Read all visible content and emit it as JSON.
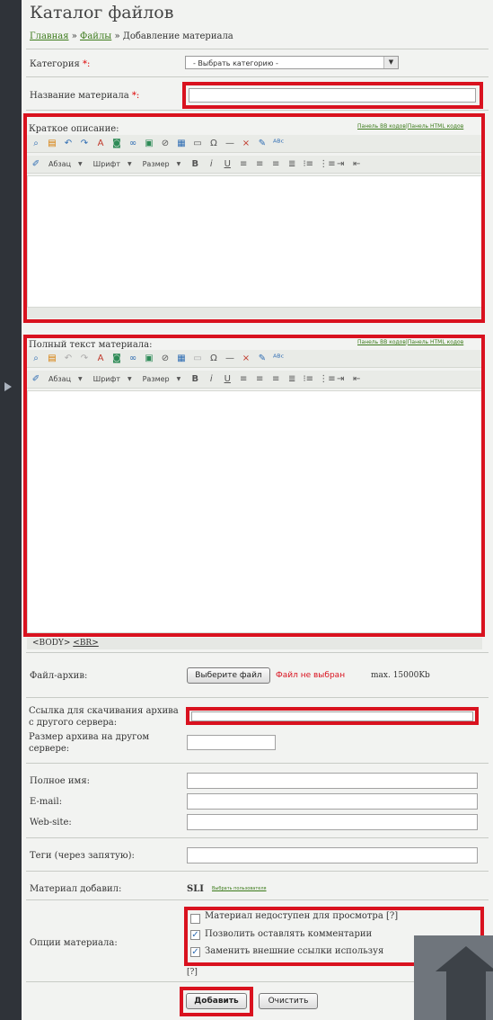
{
  "header": {
    "title": "Каталог файлов",
    "breadcrumb": {
      "home": "Главная",
      "sep1": "»",
      "files": "Файлы",
      "sep2": "»",
      "current": "Добавление материала"
    }
  },
  "form": {
    "category": {
      "label": "Категория",
      "required_mark": "*:",
      "value": "- Выбрать категорию -"
    },
    "title": {
      "label": "Название материала",
      "required_mark": "*:",
      "value": ""
    },
    "short_desc": {
      "label": "Краткое описание:"
    },
    "full_text": {
      "label": "Полный текст материала:"
    },
    "editor_links": {
      "bb": "Панель BB кодов",
      "divider": "|",
      "html": "Панель HTML кодов"
    },
    "editor_toolbar": {
      "paragraph": "Абзац",
      "font": "Шрифт",
      "size": "Размер",
      "bold": "B",
      "italic": "i",
      "underline": "U"
    },
    "status_path": {
      "body": "<BODY>",
      "br": "<BR>"
    },
    "archive": {
      "label": "Файл-архив:",
      "button": "Выберите файл",
      "no_file": "Файл не выбран",
      "max": "max. 15000Kb"
    },
    "external_link": {
      "label": "Ссылка для скачивания архива с другого сервера:",
      "value": ""
    },
    "external_size": {
      "label": "Размер архива на другом сервере:",
      "value": ""
    },
    "full_name": {
      "label": "Полное имя:",
      "value": ""
    },
    "email": {
      "label": "E-mail:",
      "value": ""
    },
    "website": {
      "label": "Web-site:",
      "value": ""
    },
    "tags": {
      "label": "Теги (через запятую):",
      "value": ""
    },
    "added_by": {
      "label": "Материал добавил:",
      "user": "SLI",
      "choose_link": "Выбрать пользователя"
    },
    "options": {
      "label": "Опции материала:",
      "items": [
        {
          "label": "Материал недоступен для просмотра [?]",
          "checked": false
        },
        {
          "label": "Позволить оставлять комментарии",
          "checked": true
        },
        {
          "label": "Заменить внешние ссылки используя",
          "checked": true
        }
      ],
      "help": "[?]"
    },
    "submit_button": "Добавить",
    "reset_button": "Очистить"
  },
  "colors": {
    "highlight": "#d9121f",
    "link": "#3b7a1a",
    "sidebar": "#2f3339"
  }
}
